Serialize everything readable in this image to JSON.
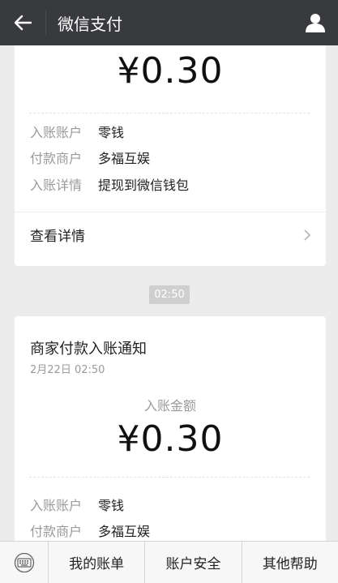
{
  "header": {
    "title": "微信支付",
    "back_icon": "arrow-left-icon",
    "profile_icon": "user-icon"
  },
  "card1": {
    "amount": "¥0.30",
    "rows": [
      {
        "key": "入账账户",
        "value": "零钱"
      },
      {
        "key": "付款商户",
        "value": "多福互娱"
      },
      {
        "key": "入账详情",
        "value": "提现到微信钱包"
      }
    ],
    "view_detail": "查看详情"
  },
  "timestamp_chip": "02:50",
  "card2": {
    "title": "商家付款入账通知",
    "date": "2月22日  02:50",
    "amount_label": "入账金额",
    "amount": "¥0.30",
    "rows": [
      {
        "key": "入账账户",
        "value": "零钱"
      },
      {
        "key": "付款商户",
        "value": "多福互娱"
      }
    ]
  },
  "bottom_menu": {
    "keyboard_icon": "keyboard-icon",
    "items": [
      "我的账单",
      "账户安全",
      "其他帮助"
    ]
  },
  "colors": {
    "topbar": "#393a3e",
    "background": "#ececec",
    "card": "#ffffff",
    "muted_text": "#9a9a9a"
  }
}
